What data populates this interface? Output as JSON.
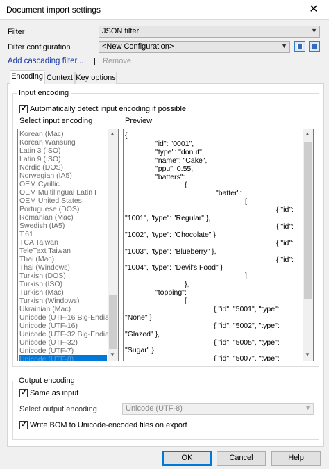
{
  "window": {
    "title": "Document import settings",
    "close_glyph": "✕"
  },
  "filter": {
    "label": "Filter",
    "value": "JSON filter"
  },
  "filter_config": {
    "label": "Filter configuration",
    "value": "<New Configuration>"
  },
  "actions": {
    "add_cascading": "Add cascading filter...",
    "separator": "|",
    "remove": "Remove"
  },
  "tabs": [
    {
      "label": "Encoding",
      "active": true
    },
    {
      "label": "Context",
      "active": false
    },
    {
      "label": "Key options",
      "active": false
    }
  ],
  "input_encoding": {
    "group_label": "Input encoding",
    "auto_detect_label": "Automatically detect input encoding if possible",
    "auto_detect_checked": true,
    "select_label": "Select input encoding",
    "preview_label": "Preview",
    "encodings": [
      "Korean (Mac)",
      "Korean Wansung",
      "Latin 3 (ISO)",
      "Latin 9 (ISO)",
      "Nordic (DOS)",
      "Norwegian (IA5)",
      "OEM Cyrillic",
      "OEM Multilingual Latin I",
      "OEM United States",
      "Portuguese (DOS)",
      "Romanian (Mac)",
      "Swedish (IA5)",
      "T.61",
      "TCA Taiwan",
      "TeleText Taiwan",
      "Thai (Mac)",
      "Thai (Windows)",
      "Turkish (DOS)",
      "Turkish (ISO)",
      "Turkish (Mac)",
      "Turkish (Windows)",
      "Ukrainian (Mac)",
      "Unicode (UTF-16 Big-Endian)",
      "Unicode (UTF-16)",
      "Unicode (UTF-32 Big-Endian)",
      "Unicode (UTF-32)",
      "Unicode (UTF-7)",
      "Unicode (UTF-8)"
    ],
    "selected_encoding": "Unicode (UTF-8)",
    "preview_lines": [
      "{",
      "\"id\": \"0001\",",
      "\"type\": \"donut\",",
      "\"name\": \"Cake\",",
      "\"ppu\": 0.55,",
      "\"batters\":",
      "{",
      "\"batter\":",
      "[",
      "{ \"id\":",
      "\"1001\", \"type\": \"Regular\" },",
      "{ \"id\":",
      "\"1002\", \"type\": \"Chocolate\" },",
      "{ \"id\":",
      "\"1003\", \"type\": \"Blueberry\" },",
      "{ \"id\":",
      "\"1004\", \"type\": \"Devil's Food\" }",
      "]",
      "},",
      "\"topping\":",
      "[",
      "{ \"id\": \"5001\", \"type\":",
      "\"None\" },",
      "{ \"id\": \"5002\", \"type\":",
      "\"Glazed\" },",
      "{ \"id\": \"5005\", \"type\":",
      "\"Sugar\" },",
      "{ \"id\": \"5007\", \"type\":"
    ]
  },
  "output_encoding": {
    "group_label": "Output encoding",
    "same_as_input_label": "Same as input",
    "same_as_input_checked": true,
    "select_label": "Select output encoding",
    "select_value": "Unicode (UTF-8)",
    "write_bom_label": "Write BOM to Unicode-encoded files on export",
    "write_bom_checked": true
  },
  "buttons": {
    "ok": "OK",
    "cancel": "Cancel",
    "help": "Help"
  },
  "colors": {
    "accent": "#0078d7",
    "link": "#1a3aa6"
  }
}
